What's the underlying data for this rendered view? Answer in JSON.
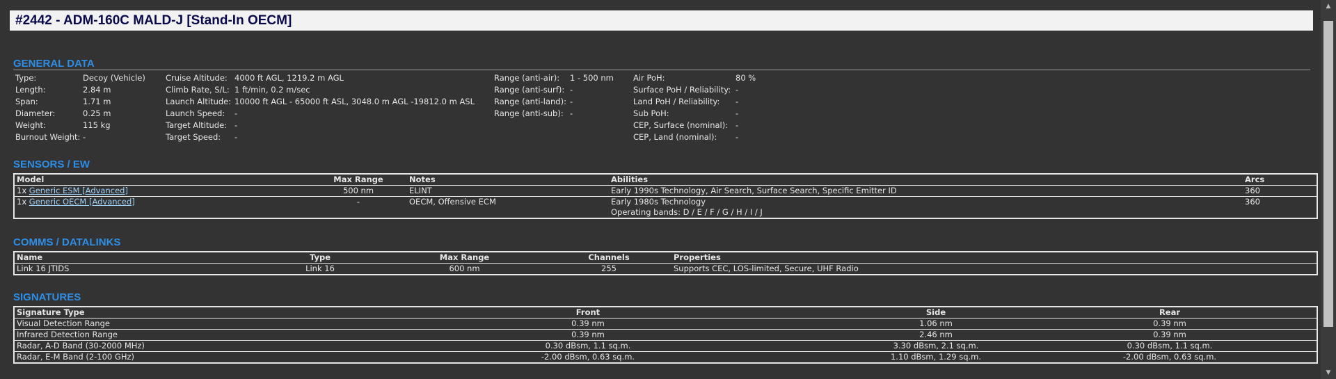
{
  "title": "#2442 - ADM-160C MALD-J [Stand-In OECM]",
  "sections": {
    "general": "GENERAL DATA",
    "sensors": "SENSORS / EW",
    "comms": "COMMS / DATALINKS",
    "signatures": "SIGNATURES"
  },
  "general": {
    "col1": [
      {
        "label": "Type:",
        "value": "Decoy (Vehicle)"
      },
      {
        "label": "Length:",
        "value": "2.84 m"
      },
      {
        "label": "Span:",
        "value": "1.71 m"
      },
      {
        "label": "Diameter:",
        "value": "0.25 m"
      },
      {
        "label": "Weight:",
        "value": "115 kg"
      },
      {
        "label": "Burnout Weight:",
        "value": "-"
      }
    ],
    "col2": [
      {
        "label": "Cruise Altitude:",
        "value": "4000 ft AGL, 1219.2 m AGL"
      },
      {
        "label": "Climb Rate, S/L:",
        "value": "1 ft/min, 0.2 m/sec"
      },
      {
        "label": "Launch Altitude:",
        "value": "10000 ft AGL - 65000 ft ASL, 3048.0 m AGL -19812.0 m ASL"
      },
      {
        "label": "Launch Speed:",
        "value": "-"
      },
      {
        "label": "Target Altitude:",
        "value": "-"
      },
      {
        "label": "Target Speed:",
        "value": "-"
      }
    ],
    "col3": [
      {
        "label": "Range (anti-air):",
        "value": "1 - 500 nm"
      },
      {
        "label": "Range (anti-surf):",
        "value": "-"
      },
      {
        "label": "Range (anti-land):",
        "value": "-"
      },
      {
        "label": "Range (anti-sub):",
        "value": "-"
      }
    ],
    "col4": [
      {
        "label": "Air PoH:",
        "value": "80 %"
      },
      {
        "label": "Surface PoH / Reliability:",
        "value": "-"
      },
      {
        "label": "Land PoH / Reliability:",
        "value": "-"
      },
      {
        "label": "Sub PoH:",
        "value": "-"
      },
      {
        "label": "CEP, Surface (nominal):",
        "value": "-"
      },
      {
        "label": "CEP, Land (nominal):",
        "value": "-"
      }
    ]
  },
  "sensors": {
    "headers": [
      "Model",
      "Max Range",
      "Notes",
      "Abilities",
      "Arcs"
    ],
    "rows": [
      {
        "qty": "1x",
        "model": "Generic ESM [Advanced]",
        "range": "500 nm",
        "notes": "ELINT",
        "abilities": [
          "Early 1990s Technology, Air Search, Surface Search, Specific Emitter ID"
        ],
        "arcs": "360"
      },
      {
        "qty": "1x",
        "model": "Generic OECM [Advanced]",
        "range": "-",
        "notes": "OECM, Offensive ECM",
        "abilities": [
          "Early 1980s Technology",
          "Operating bands: D / E / F / G / H / I / J"
        ],
        "arcs": "360"
      }
    ]
  },
  "comms": {
    "headers": [
      "Name",
      "Type",
      "Max Range",
      "Channels",
      "Properties"
    ],
    "rows": [
      {
        "name": "Link 16 JTIDS",
        "type": "Link 16",
        "range": "600 nm",
        "channels": "255",
        "properties": "Supports CEC, LOS-limited, Secure, UHF Radio"
      }
    ]
  },
  "signatures": {
    "headers": [
      "Signature Type",
      "Front",
      "Side",
      "Rear"
    ],
    "rows": [
      {
        "type": "Visual Detection Range",
        "front": "0.39 nm",
        "side": "1.06 nm",
        "rear": "0.39 nm"
      },
      {
        "type": "Infrared Detection Range",
        "front": "0.39 nm",
        "side": "2.46 nm",
        "rear": "0.39 nm"
      },
      {
        "type": "Radar, A-D Band (30-2000 MHz)",
        "front": "0.30 dBsm, 1.1 sq.m.",
        "side": "3.30 dBsm, 2.1 sq.m.",
        "rear": "0.30 dBsm, 1.1 sq.m."
      },
      {
        "type": "Radar, E-M Band (2-100 GHz)",
        "front": "-2.00 dBsm, 0.63 sq.m.",
        "side": "1.10 dBsm, 1.29 sq.m.",
        "rear": "-2.00 dBsm, 0.63 sq.m."
      }
    ]
  }
}
